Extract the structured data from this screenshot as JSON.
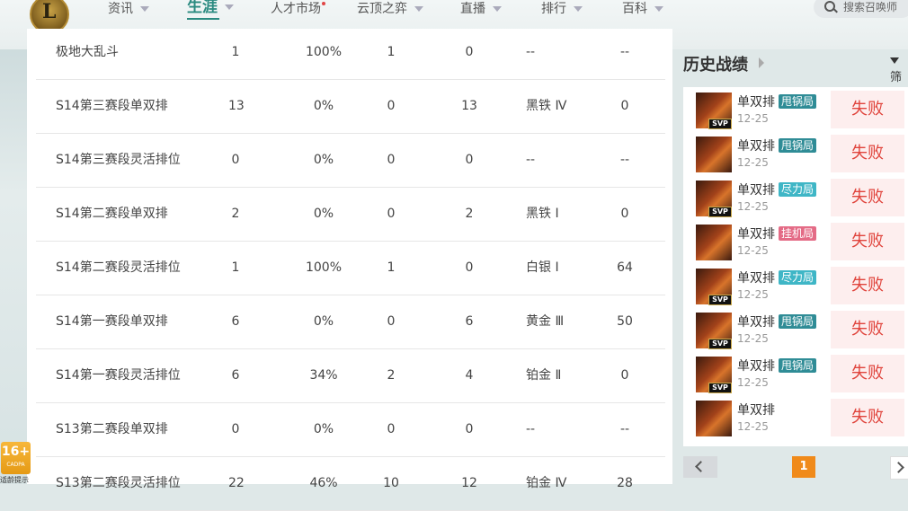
{
  "nav": {
    "items": [
      {
        "label": "资讯"
      },
      {
        "label": "生涯"
      },
      {
        "label": "人才市场"
      },
      {
        "label": "云顶之弈"
      },
      {
        "label": "直播"
      },
      {
        "label": "排行"
      },
      {
        "label": "百科"
      }
    ],
    "active": "生涯",
    "search_placeholder": "搜索召唤师"
  },
  "table": {
    "rows": [
      {
        "name": "极地大乱斗",
        "total": "1",
        "rate": "100%",
        "win": "1",
        "lose": "0",
        "tier": "--",
        "points": "--"
      },
      {
        "name": "S14第三赛段单双排",
        "total": "13",
        "rate": "0%",
        "win": "0",
        "lose": "13",
        "tier": "黑铁 Ⅳ",
        "points": "0"
      },
      {
        "name": "S14第三赛段灵活排位",
        "total": "0",
        "rate": "0%",
        "win": "0",
        "lose": "0",
        "tier": "--",
        "points": "--"
      },
      {
        "name": "S14第二赛段单双排",
        "total": "2",
        "rate": "0%",
        "win": "0",
        "lose": "2",
        "tier": "黑铁 Ⅰ",
        "points": "0"
      },
      {
        "name": "S14第二赛段灵活排位",
        "total": "1",
        "rate": "100%",
        "win": "1",
        "lose": "0",
        "tier": "白银 Ⅰ",
        "points": "64"
      },
      {
        "name": "S14第一赛段单双排",
        "total": "6",
        "rate": "0%",
        "win": "0",
        "lose": "6",
        "tier": "黄金 Ⅲ",
        "points": "50"
      },
      {
        "name": "S14第一赛段灵活排位",
        "total": "6",
        "rate": "34%",
        "win": "2",
        "lose": "4",
        "tier": "铂金 Ⅱ",
        "points": "0"
      },
      {
        "name": "S13第二赛段单双排",
        "total": "0",
        "rate": "0%",
        "win": "0",
        "lose": "0",
        "tier": "--",
        "points": "--"
      },
      {
        "name": "S13第二赛段灵活排位",
        "total": "22",
        "rate": "46%",
        "win": "10",
        "lose": "12",
        "tier": "铂金 Ⅳ",
        "points": "28"
      }
    ]
  },
  "history": {
    "title": "历史战绩",
    "filter_label": "筛",
    "matches": [
      {
        "mode": "单双排",
        "tag": "甩锅局",
        "tag_color": "#2f8c96",
        "date": "12-25",
        "result": "失败",
        "svp": "SVP"
      },
      {
        "mode": "单双排",
        "tag": "甩锅局",
        "tag_color": "#2f8c96",
        "date": "12-25",
        "result": "失败",
        "svp": ""
      },
      {
        "mode": "单双排",
        "tag": "尽力局",
        "tag_color": "#3fb6c6",
        "date": "12-25",
        "result": "失败",
        "svp": "SVP"
      },
      {
        "mode": "单双排",
        "tag": "挂机局",
        "tag_color": "#e46b86",
        "date": "12-25",
        "result": "失败",
        "svp": ""
      },
      {
        "mode": "单双排",
        "tag": "尽力局",
        "tag_color": "#3fb6c6",
        "date": "12-25",
        "result": "失败",
        "svp": "SVP"
      },
      {
        "mode": "单双排",
        "tag": "甩锅局",
        "tag_color": "#2f8c96",
        "date": "12-25",
        "result": "失败",
        "svp": "SVP"
      },
      {
        "mode": "单双排",
        "tag": "甩锅局",
        "tag_color": "#2f8c96",
        "date": "12-25",
        "result": "失败",
        "svp": "SVP"
      },
      {
        "mode": "单双排",
        "tag": "",
        "tag_color": "",
        "date": "12-25",
        "result": "失败",
        "svp": ""
      }
    ],
    "current_page": "1"
  },
  "age_rating": {
    "label": "16+",
    "sub": "CADPA",
    "note": "适龄提示"
  },
  "colors": {
    "accent": "#2a8a80",
    "loss": "#e0443c",
    "page_active": "#f08a1a"
  }
}
